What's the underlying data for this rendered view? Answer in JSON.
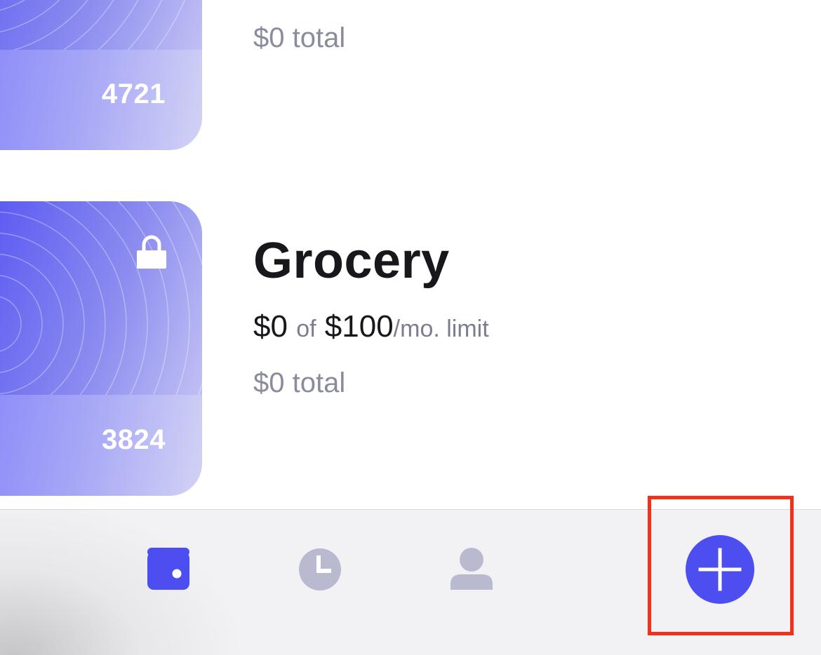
{
  "cards": [
    {
      "last_digits": "4721",
      "total": "$0 total"
    },
    {
      "name": "Grocery",
      "spent": "$0",
      "of_label": "of",
      "limit": "$100",
      "limit_suffix": "/mo. limit",
      "total": "$0 total",
      "last_digits": "3824",
      "locked": true
    }
  ],
  "tabbar": {
    "tabs": [
      {
        "icon": "wallet-icon",
        "active": true
      },
      {
        "icon": "clock-icon",
        "active": false
      },
      {
        "icon": "person-icon",
        "active": false
      }
    ],
    "add_icon": "plus-icon"
  },
  "colors": {
    "accent": "#4c4ef0",
    "inactive_icon": "#b9b9cf",
    "highlight": "#f2311c",
    "muted_text": "#7c7e8e"
  }
}
